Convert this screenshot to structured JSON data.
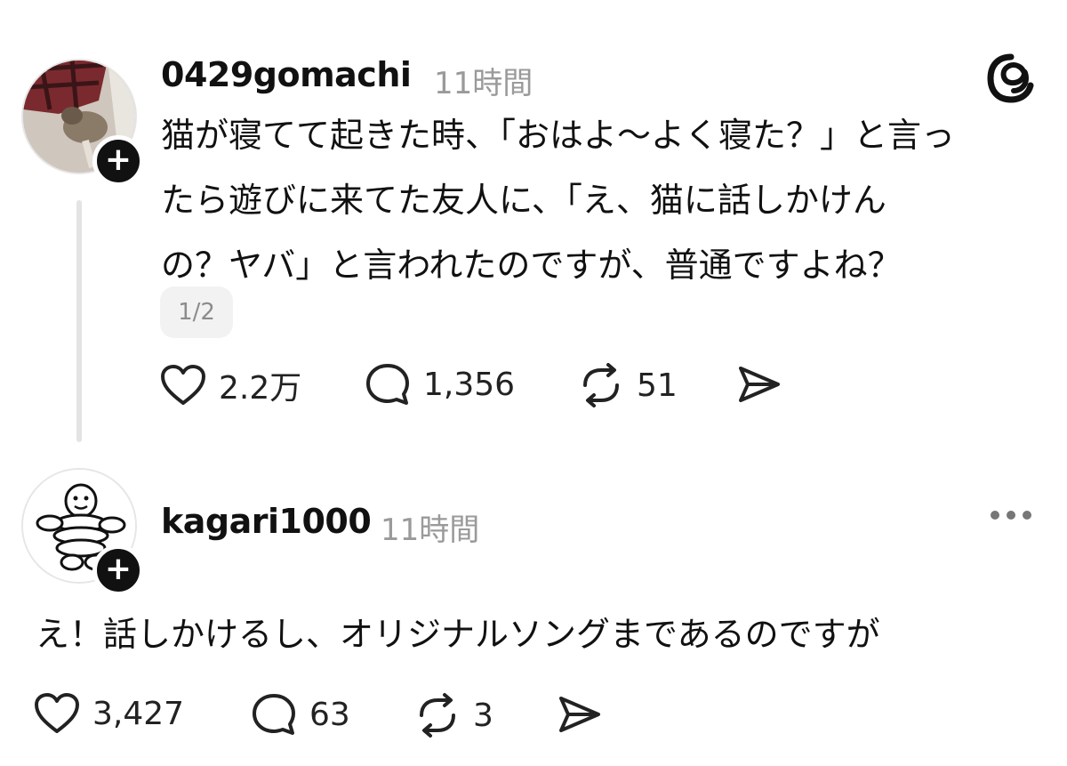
{
  "posts": [
    {
      "username": "0429gomachi",
      "time": "11時間",
      "text": "猫が寝てて起きた時、「おはよ〜よく寝た？」と言っ\nたら遊びに来てた友人に、「え、猫に話しかけん\nの？ヤバ」と言われたのですが、普通ですよね？",
      "page_indicator": "1/2",
      "likes": "2.2万",
      "replies": "1,356",
      "reposts": "51",
      "avatar_icon": "cat-photo-avatar"
    },
    {
      "username": "kagari1000",
      "time": "11時間",
      "text": "え！話しかけるし、オリジナルソングまであるのですが",
      "likes": "3,427",
      "replies": "63",
      "reposts": "3",
      "avatar_icon": "michelin-man-avatar"
    }
  ],
  "icons": {
    "like": "heart-icon",
    "reply": "comment-icon",
    "repost": "repost-icon",
    "share": "share-icon",
    "follow": "plus-icon",
    "app": "threads-logo-icon",
    "more": "more-icon"
  }
}
